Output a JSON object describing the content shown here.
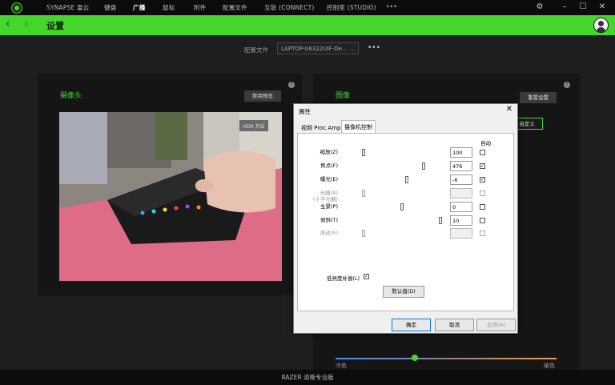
{
  "topbar": {
    "nav": [
      "SYNAPSE 雷云",
      "键盘",
      "广播",
      "鼠标",
      "附件",
      "配置文件",
      "互联 (CONNECT)",
      "控制室 (STUDIO)",
      "•••"
    ],
    "active_index": 2
  },
  "header": {
    "title": "设置"
  },
  "profile": {
    "label": "配置文件",
    "value": "LAPTOP-U6322UIF-De..."
  },
  "camera_panel": {
    "title": "摄像头",
    "preview_button": "禁用预览",
    "overlay_button": "HDR 开启"
  },
  "image_panel": {
    "title": "图像",
    "reset_button": "重置设置",
    "custom_button": "自定义",
    "slider_left": "冷色",
    "slider_right": "暖色"
  },
  "footer": {
    "text": "RAZER 清晰专业版"
  },
  "dialog": {
    "title": "属性",
    "tabs": [
      "视频 Proc Amp",
      "摄像机控制"
    ],
    "auto_label": "自动",
    "rows": [
      {
        "label": "缩放(Z)",
        "value": "100",
        "pos": 0.0,
        "auto": false,
        "enabled": true
      },
      {
        "label": "焦点(F)",
        "value": "476",
        "pos": 0.78,
        "auto": true,
        "enabled": true
      },
      {
        "label": "曝光(E)",
        "value": "-6",
        "pos": 0.56,
        "auto": true,
        "enabled": true
      },
      {
        "label": "光圈(A)",
        "label2": "(十字光圈)",
        "value": "",
        "pos": 0.0,
        "auto": false,
        "enabled": false
      },
      {
        "label": "全景(P)",
        "value": "0",
        "pos": 0.5,
        "auto": false,
        "enabled": true
      },
      {
        "label": "倾斜(T)",
        "value": "10",
        "pos": 1.0,
        "auto": false,
        "enabled": true
      },
      {
        "label": "滚动(R)",
        "value": "",
        "pos": 0.0,
        "auto": false,
        "enabled": false
      }
    ],
    "low_light_label": "低亮度补偿(L)",
    "low_light_checked": true,
    "default_button": "默认值(D)",
    "ok": "确定",
    "cancel": "取消",
    "apply": "应用(A)"
  }
}
